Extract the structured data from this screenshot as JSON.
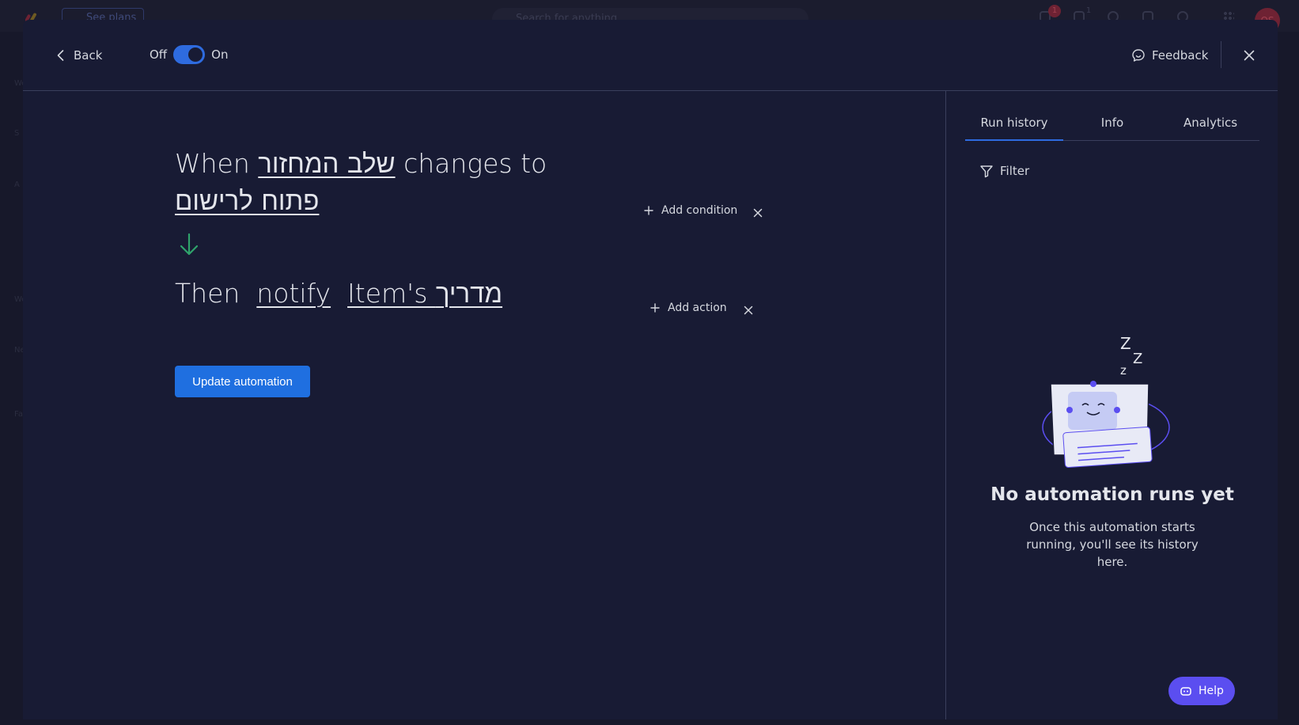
{
  "background": {
    "see_plans": "See plans",
    "search_placeholder": "Search for anything",
    "notifications_badge": "1",
    "inbox_badge": "1",
    "avatar_initials": "OS",
    "sidebar_letters": [
      "Wo",
      "S",
      "A",
      "Wo",
      "Ne",
      "Fa"
    ]
  },
  "header": {
    "back_label": "Back",
    "toggle_off_label": "Off",
    "toggle_on_label": "On",
    "toggle_state": "on",
    "feedback_label": "Feedback"
  },
  "trigger": {
    "when_word": "When",
    "column_name": "שלב המחזור",
    "changes_to": "changes to",
    "status_value": "פתוח לרישום",
    "add_condition_label": "Add condition"
  },
  "action": {
    "then_word": "Then",
    "action_name": "notify",
    "target": "Item's מדריך",
    "add_action_label": "Add action"
  },
  "update_button_label": "Update automation",
  "right_panel": {
    "tabs": [
      {
        "label": "Run history",
        "active": true
      },
      {
        "label": "Info",
        "active": false
      },
      {
        "label": "Analytics",
        "active": false
      }
    ],
    "filter_label": "Filter",
    "empty_title": "No automation runs yet",
    "empty_description": "Once this automation starts running, you'll see its history here."
  },
  "help_label": "Help",
  "colors": {
    "accent_blue": "#1f6fe0",
    "toggle_blue": "#2e6bdf",
    "arrow_green": "#2fa36b",
    "help_purple": "#5b4ef0",
    "modal_bg": "#181b34"
  }
}
